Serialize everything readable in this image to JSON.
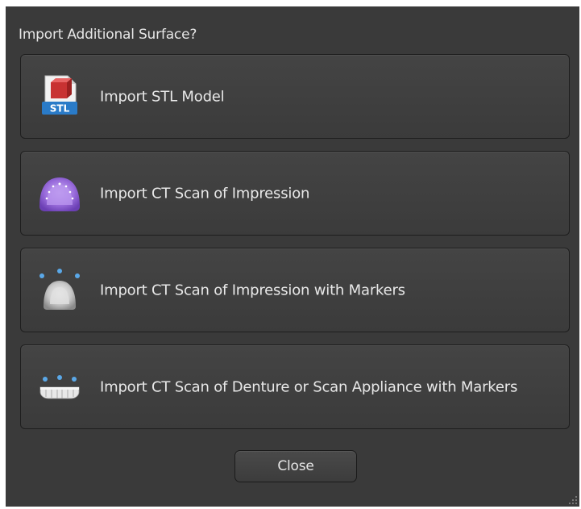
{
  "dialog": {
    "title": "Import Additional Surface?",
    "options": [
      {
        "label": "Import STL Model",
        "icon": "stl-file-icon"
      },
      {
        "label": "Import CT Scan of Impression",
        "icon": "impression-icon"
      },
      {
        "label": "Import CT Scan of Impression with Markers",
        "icon": "impression-markers-icon"
      },
      {
        "label": "Import CT Scan of Denture or Scan Appliance with Markers",
        "icon": "denture-markers-icon"
      }
    ],
    "close_label": "Close",
    "stl_badge_text": "STL"
  },
  "colors": {
    "background": "#3a3a3a",
    "button": "#444444",
    "text": "#e8e8e8",
    "impression_purple": "#9a6ddc",
    "marker_blue": "#5aa8e8",
    "stl_badge_blue": "#2a7bc8",
    "stl_cube_red": "#d94040"
  }
}
